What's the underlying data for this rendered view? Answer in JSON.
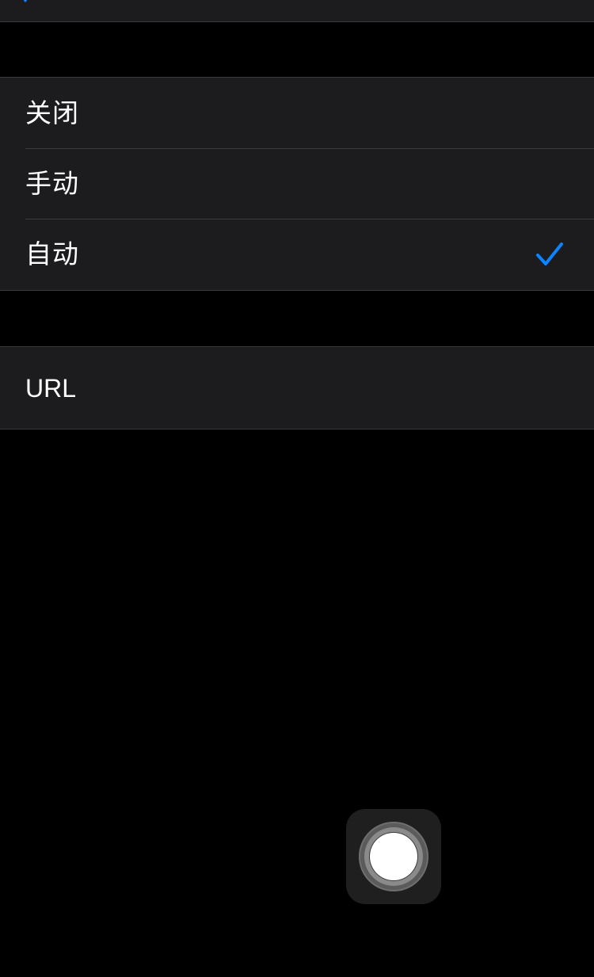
{
  "colors": {
    "background": "#000000",
    "cell_background": "#1c1c1e",
    "separator": "#3a3a3c",
    "accent": "#0a84ff",
    "text": "#ffffff"
  },
  "proxy_options": {
    "items": [
      {
        "label": "关闭",
        "selected": false
      },
      {
        "label": "手动",
        "selected": false
      },
      {
        "label": "自动",
        "selected": true
      }
    ]
  },
  "url_field": {
    "label": "URL"
  },
  "icons": {
    "selected": "checkmark-icon",
    "assistive_touch": "assistive-touch-icon"
  }
}
